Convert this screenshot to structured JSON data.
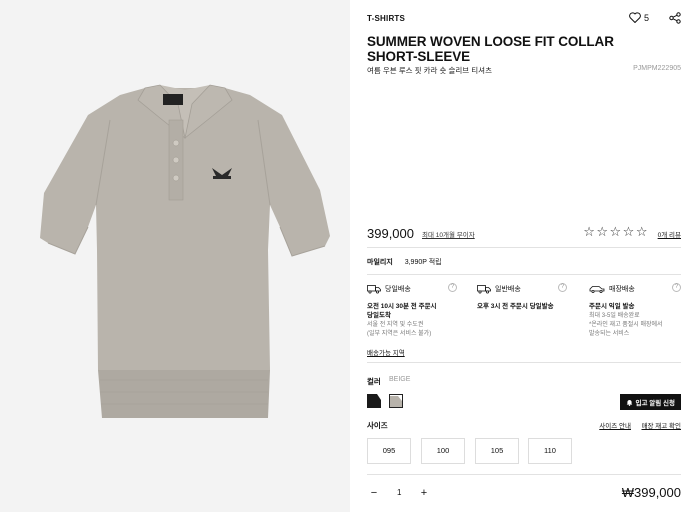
{
  "product": {
    "category": "T-SHIRTS",
    "like_count": "5",
    "title": "SUMMER WOVEN LOOSE FIT COLLAR SHORT-SLEEVE",
    "subtitle_kr": "여름 우븐 루스 핏 카라 숏 슬리브 티셔츠",
    "sku": "PJMPM222905",
    "price": "399,000",
    "installment": "최대 10개월 무이자",
    "stars": "☆☆☆☆☆",
    "review_link": "0개 리뷰"
  },
  "mileage": {
    "label": "마일리지",
    "value": "3,990P 적립"
  },
  "delivery": {
    "same_day": {
      "label": "당일배송",
      "title_lines": [
        "오전 10시 30분 전 주문시",
        "당일도착"
      ],
      "desc_lines": [
        "서울 전 지역 및 수도권",
        "(일부 지역은 서비스 불가)"
      ]
    },
    "standard": {
      "label": "일반배송",
      "title_lines": [
        "오후 3시 전 주문시 당일발송"
      ],
      "desc_lines": []
    },
    "store": {
      "label": "매장배송",
      "title_lines": [
        "주문시 익일 발송"
      ],
      "desc_lines": [
        "최대 3-5일 배송완료",
        "*온라인 재고 품절시 매장에서",
        "발송되는 서비스"
      ]
    },
    "available_area_link": "배송가능 지역"
  },
  "color": {
    "label": "컬러",
    "value": "BEIGE",
    "swatches": [
      {
        "name": "black",
        "hex": "#1a1a1a"
      },
      {
        "name": "beige",
        "hex": "#b8b3ab"
      }
    ]
  },
  "restock_button": "입고 알림 신청",
  "size": {
    "label": "사이즈",
    "guide_link": "사이즈 안내",
    "stock_link": "매장 재고 확인",
    "options": [
      "095",
      "100",
      "105",
      "110"
    ]
  },
  "quantity": {
    "minus": "−",
    "value": "1",
    "plus": "+"
  },
  "total": "₩399,000",
  "colors": {
    "accent": "#111111",
    "shirt": "#b9b4ac"
  }
}
